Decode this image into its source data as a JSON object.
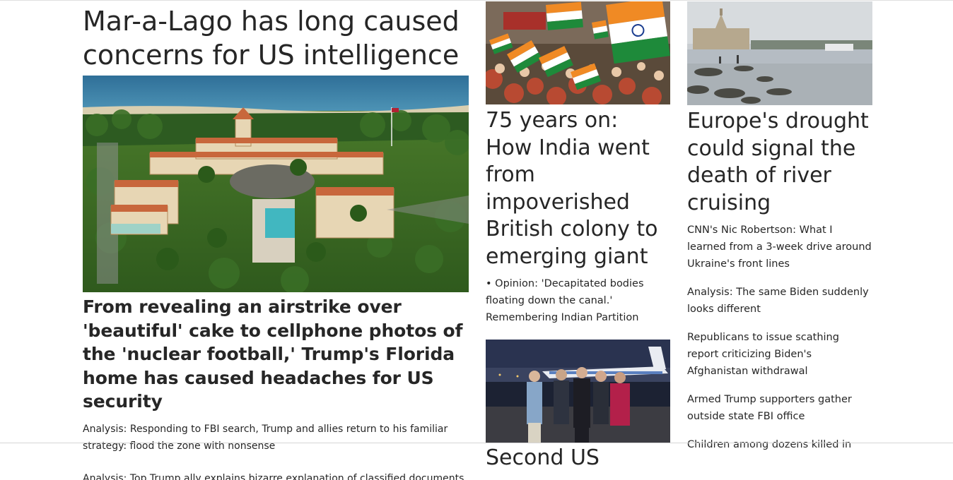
{
  "main": {
    "headline": "Mar-a-Lago has long caused concerns for US intelligence",
    "subheadline": "From revealing an airstrike over 'beautiful' cake to cellphone photos of the 'nuclear football,' Trump's Florida home has caused headaches for US security",
    "analysis": "Analysis: Responding to FBI search, Trump and allies return to his familiar strategy: flood the zone with nonsense",
    "next_link": "Analysis: Top Trump ally explains bizarre explanation of classified documents"
  },
  "india": {
    "headline": "75 years on: How India went from impoverished British colony to emerging giant",
    "opinion": "• Opinion: 'Decapitated bodies floating down the canal.' Remembering Indian Partition"
  },
  "second": {
    "headline": "Second US"
  },
  "europe": {
    "headline": "Europe's drought could signal the death of river cruising",
    "links": [
      "CNN's Nic Robertson: What I learned from a 3-week drive around Ukraine's front lines",
      "Analysis: The same Biden suddenly looks different",
      "Republicans to issue scathing report criticizing Biden's Afghanistan withdrawal",
      "Armed Trump supporters gather outside state FBI office",
      "Children among dozens killed in"
    ]
  }
}
